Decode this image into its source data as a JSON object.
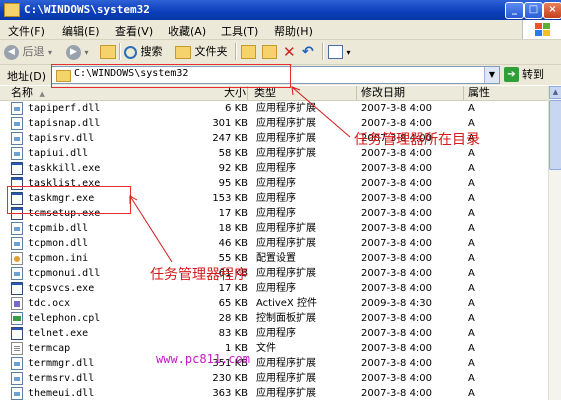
{
  "window": {
    "title": "C:\\WINDOWS\\system32"
  },
  "menu": [
    "文件(F)",
    "编辑(E)",
    "查看(V)",
    "收藏(A)",
    "工具(T)",
    "帮助(H)"
  ],
  "toolbar": {
    "back": "后退",
    "search": "搜索",
    "folders": "文件夹"
  },
  "address": {
    "label": "地址(D)",
    "path": "C:\\WINDOWS\\system32",
    "go": "转到"
  },
  "columns": {
    "name": "名称",
    "size": "大小",
    "type": "类型",
    "modified": "修改日期",
    "attr": "属性"
  },
  "files": [
    {
      "name": "tapiperf.dll",
      "size": "6 KB",
      "type": "应用程序扩展",
      "date": "2007-3-8 4:00",
      "attr": "A",
      "icon": "dll-icon"
    },
    {
      "name": "tapisnap.dll",
      "size": "301 KB",
      "type": "应用程序扩展",
      "date": "2007-3-8 4:00",
      "attr": "A",
      "icon": "dll-icon"
    },
    {
      "name": "tapisrv.dll",
      "size": "247 KB",
      "type": "应用程序扩展",
      "date": "2007-3-8 4:00",
      "attr": "A",
      "icon": "dll-icon"
    },
    {
      "name": "tapiui.dll",
      "size": "58 KB",
      "type": "应用程序扩展",
      "date": "2007-3-8 4:00",
      "attr": "A",
      "icon": "dll-icon"
    },
    {
      "name": "taskkill.exe",
      "size": "92 KB",
      "type": "应用程序",
      "date": "2007-3-8 4:00",
      "attr": "A",
      "icon": "exe-icon"
    },
    {
      "name": "tasklist.exe",
      "size": "95 KB",
      "type": "应用程序",
      "date": "2007-3-8 4:00",
      "attr": "A",
      "icon": "exe-icon"
    },
    {
      "name": "taskmgr.exe",
      "size": "153 KB",
      "type": "应用程序",
      "date": "2007-3-8 4:00",
      "attr": "A",
      "icon": "exe-icon"
    },
    {
      "name": "tcmsetup.exe",
      "size": "17 KB",
      "type": "应用程序",
      "date": "2007-3-8 4:00",
      "attr": "A",
      "icon": "exe-icon"
    },
    {
      "name": "tcpmib.dll",
      "size": "18 KB",
      "type": "应用程序扩展",
      "date": "2007-3-8 4:00",
      "attr": "A",
      "icon": "dll-icon"
    },
    {
      "name": "tcpmon.dll",
      "size": "46 KB",
      "type": "应用程序扩展",
      "date": "2007-3-8 4:00",
      "attr": "A",
      "icon": "dll-icon"
    },
    {
      "name": "tcpmon.ini",
      "size": "55 KB",
      "type": "配置设置",
      "date": "2007-3-8 4:00",
      "attr": "A",
      "icon": "ini-icon"
    },
    {
      "name": "tcpmonui.dll",
      "size": "61 KB",
      "type": "应用程序扩展",
      "date": "2007-3-8 4:00",
      "attr": "A",
      "icon": "dll-icon"
    },
    {
      "name": "tcpsvcs.exe",
      "size": "17 KB",
      "type": "应用程序",
      "date": "2007-3-8 4:00",
      "attr": "A",
      "icon": "exe-icon"
    },
    {
      "name": "tdc.ocx",
      "size": "65 KB",
      "type": "ActiveX 控件",
      "date": "2009-3-8 4:30",
      "attr": "A",
      "icon": "ocx-icon"
    },
    {
      "name": "telephon.cpl",
      "size": "28 KB",
      "type": "控制面板扩展",
      "date": "2007-3-8 4:00",
      "attr": "A",
      "icon": "cpl-icon"
    },
    {
      "name": "telnet.exe",
      "size": "83 KB",
      "type": "应用程序",
      "date": "2007-3-8 4:00",
      "attr": "A",
      "icon": "exe-icon"
    },
    {
      "name": "termcap",
      "size": "1 KB",
      "type": "文件",
      "date": "2007-3-8 4:00",
      "attr": "A",
      "icon": "file-icon"
    },
    {
      "name": "termmgr.dll",
      "size": "351 KB",
      "type": "应用程序扩展",
      "date": "2007-3-8 4:00",
      "attr": "A",
      "icon": "dll-icon"
    },
    {
      "name": "termsrv.dll",
      "size": "230 KB",
      "type": "应用程序扩展",
      "date": "2007-3-8 4:00",
      "attr": "A",
      "icon": "dll-icon"
    },
    {
      "name": "themeui.dll",
      "size": "363 KB",
      "type": "应用程序扩展",
      "date": "2007-3-8 4:00",
      "attr": "A",
      "icon": "dll-icon"
    }
  ],
  "annotations": {
    "directory_note": "任务管理器所在目录",
    "program_note": "任务管理器程序",
    "watermark": "www.pc811.com"
  },
  "colors": {
    "annotation": "#d51a1a",
    "titlebar": "#0a3db8",
    "watermark": "#c61ac6"
  }
}
